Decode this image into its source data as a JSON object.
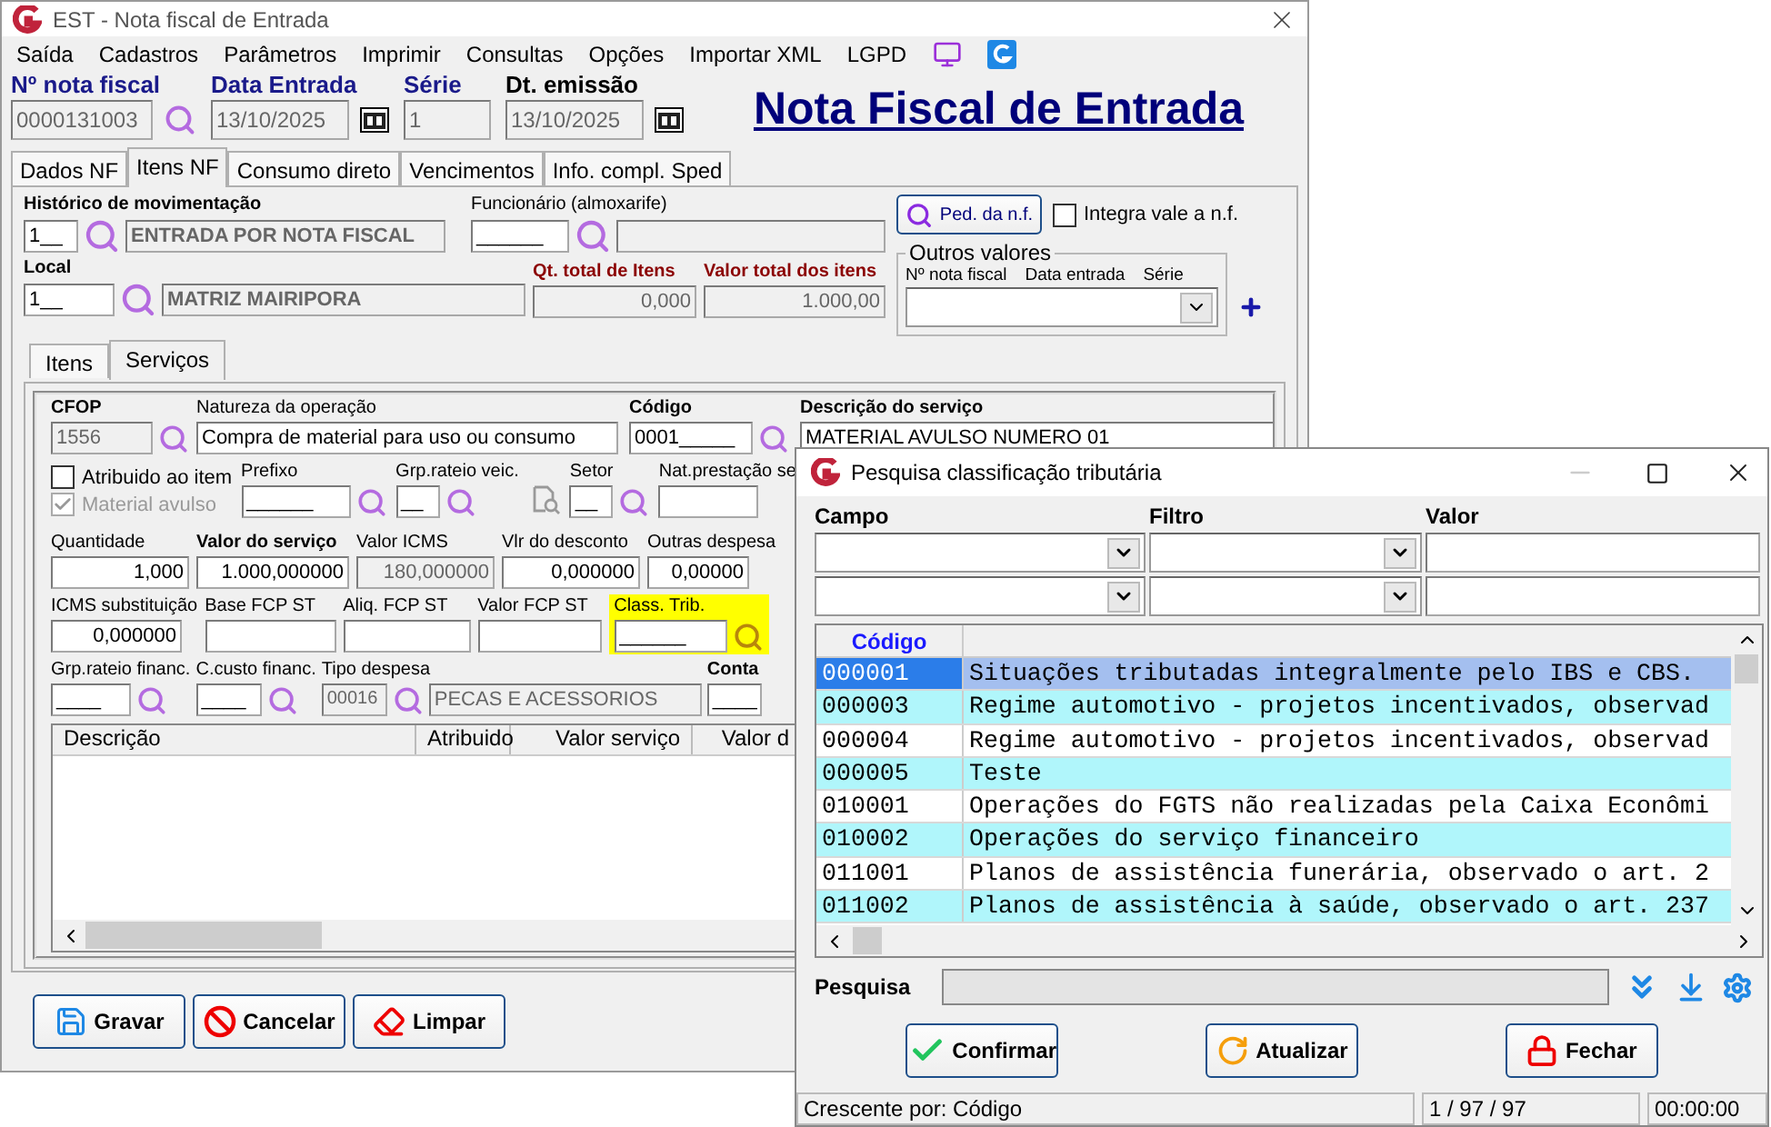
{
  "main_window": {
    "title": "EST - Nota fiscal de Entrada",
    "menu": [
      "Saída",
      "Cadastros",
      "Parâmetros",
      "Imprimir",
      "Consultas",
      "Opções",
      "Importar XML",
      "LGPD"
    ],
    "header_fields": [
      {
        "label": "Nº nota fiscal",
        "value": "0000131003",
        "kind": "search"
      },
      {
        "label": "Data Entrada",
        "value": "13/10/2025",
        "kind": "date"
      },
      {
        "label": "Série",
        "value": "1",
        "kind": "plain"
      },
      {
        "label": "Dt. emissão",
        "value": "13/10/2025",
        "kind": "date"
      }
    ],
    "heading": "Nota Fiscal de Entrada",
    "tabs": [
      {
        "label": "Dados NF",
        "selected": false
      },
      {
        "label": "Itens NF",
        "selected": true
      },
      {
        "label": "Consumo direto",
        "selected": false
      },
      {
        "label": "Vencimentos",
        "selected": false
      },
      {
        "label": "Info. compl. Sped",
        "selected": false
      }
    ],
    "itens_nf": {
      "historico": {
        "label": "Histórico de movimentação",
        "code": "1__",
        "description": "ENTRADA POR NOTA FISCAL"
      },
      "funcionario": {
        "label": "Funcionário (almoxarife)",
        "code": "______"
      },
      "ped_button": "Ped. da n.f.",
      "integra_vale": {
        "label": "Integra vale a n.f.",
        "checked": false
      },
      "local": {
        "label": "Local",
        "code": "1__",
        "description": "MATRIZ MAIRIPORA"
      },
      "qt_total": {
        "label": "Qt. total de Itens",
        "value": "0,000"
      },
      "valor_total": {
        "label": "Valor total dos itens",
        "value": "1.000,00"
      },
      "outros_valores": {
        "title": "Outros valores",
        "columns": [
          "Nº nota fiscal",
          "Data entrada",
          "Série"
        ]
      },
      "subtabs": [
        {
          "label": "Itens",
          "selected": false
        },
        {
          "label": "Serviços",
          "selected": true
        }
      ],
      "servicos": {
        "cfop": {
          "label": "CFOP",
          "value": "1556"
        },
        "natureza": {
          "label": "Natureza da operação",
          "value": "Compra de material para uso ou consumo"
        },
        "codigo": {
          "label": "Código",
          "value": "0001_____"
        },
        "descricao": {
          "label": "Descrição do serviço",
          "value": "MATERIAL AVULSO NUMERO 01"
        },
        "atribuido": {
          "label": "Atribuido ao item",
          "checked": false,
          "disabled": false
        },
        "material_avulso": {
          "label": "Material avulso",
          "checked": true,
          "disabled": true
        },
        "prefixo": {
          "label": "Prefixo",
          "value": "______"
        },
        "grp_rateio_veic": {
          "label": "Grp.rateio veic.",
          "value": "__"
        },
        "setor": {
          "label": "Setor",
          "value": "__"
        },
        "nat_prestacao": {
          "label": "Nat.prestação se"
        },
        "quantidade": {
          "label": "Quantidade",
          "value": "1,000"
        },
        "valor_servico": {
          "label": "Valor do serviço",
          "value": "1.000,000000"
        },
        "valor_icms": {
          "label": "Valor ICMS",
          "value": "180,000000"
        },
        "vlr_desconto": {
          "label": "Vlr do desconto",
          "value": "0,000000"
        },
        "outras_despesas": {
          "label": "Outras despesa",
          "value": "0,00000"
        },
        "icms_st": {
          "label": "ICMS substituição",
          "value": "0,000000"
        },
        "base_fcp": {
          "label": "Base FCP ST"
        },
        "aliq_fcp": {
          "label": "Aliq. FCP ST"
        },
        "valor_fcp": {
          "label": "Valor FCP ST"
        },
        "class_trib": {
          "label": "Class. Trib.",
          "value": "______",
          "highlighted": true
        },
        "grp_rateio_fin": {
          "label": "Grp.rateio financ.",
          "value": "____"
        },
        "ccusto_fin": {
          "label": "C.custo financ.",
          "value": "____"
        },
        "tipo_despesa": {
          "label": "Tipo despesa",
          "code": "00016",
          "description": "PECAS E ACESSORIOS"
        },
        "conta": {
          "label": "Conta",
          "value": "____"
        },
        "table_columns": [
          "Descrição",
          "Atribuido",
          "Valor serviço",
          "Valor d"
        ]
      }
    },
    "buttons": [
      {
        "label": "Gravar",
        "kind": "save"
      },
      {
        "label": "Cancelar",
        "kind": "cancel"
      },
      {
        "label": "Limpar",
        "kind": "clear"
      }
    ]
  },
  "dialog": {
    "title": "Pesquisa classificação tributária",
    "filter_labels": [
      "Campo",
      "Filtro",
      "Valor"
    ],
    "grid_column": "Código",
    "rows": [
      {
        "code": "000001",
        "description": "Situações tributadas integralmente pelo IBS e CBS.",
        "selected": true
      },
      {
        "code": "000003",
        "description": "Regime automotivo - projetos incentivados, observad",
        "selected": false
      },
      {
        "code": "000004",
        "description": "Regime automotivo - projetos incentivados, observad",
        "selected": false
      },
      {
        "code": "000005",
        "description": "Teste",
        "selected": false
      },
      {
        "code": "010001",
        "description": "Operações do FGTS não realizadas pela Caixa Econômi",
        "selected": false
      },
      {
        "code": "010002",
        "description": "Operações do serviço financeiro",
        "selected": false
      },
      {
        "code": "011001",
        "description": "Planos de assistência funerária, observado o art. 2",
        "selected": false
      },
      {
        "code": "011002",
        "description": "Planos de assistência à saúde, observado o art. 237",
        "selected": false
      }
    ],
    "search_label": "Pesquisa",
    "buttons": [
      {
        "label": "Confirmar",
        "kind": "confirm"
      },
      {
        "label": "Atualizar",
        "kind": "refresh"
      },
      {
        "label": "Fechar",
        "kind": "close"
      }
    ],
    "status": [
      "Crescente por: Código",
      "1 / 97 / 97",
      "00:00:00"
    ]
  }
}
